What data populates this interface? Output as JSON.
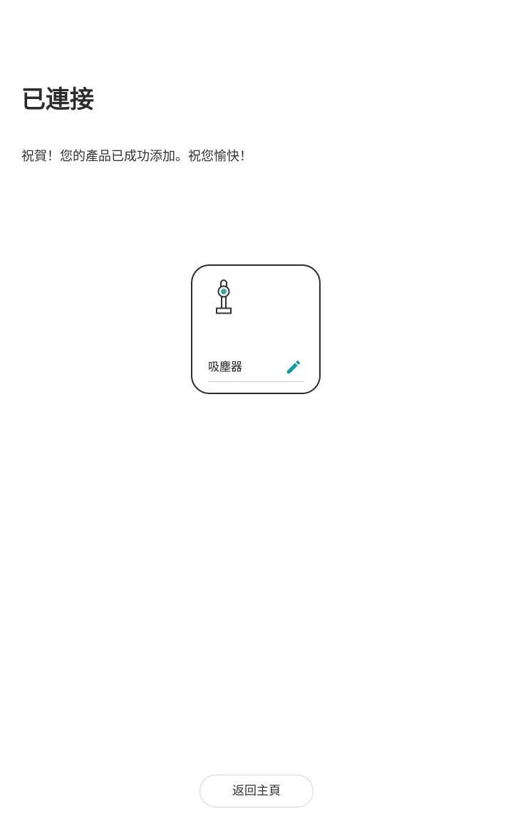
{
  "header": {
    "title": "已連接",
    "subtitle": "祝賀！您的產品已成功添加。祝您愉快！"
  },
  "device_card": {
    "icon": "vacuum-cleaner-icon",
    "name": "吸塵器",
    "edit_icon": "pencil-icon",
    "accent_color": "#0f9ba8"
  },
  "footer": {
    "home_button_label": "返回主頁"
  }
}
